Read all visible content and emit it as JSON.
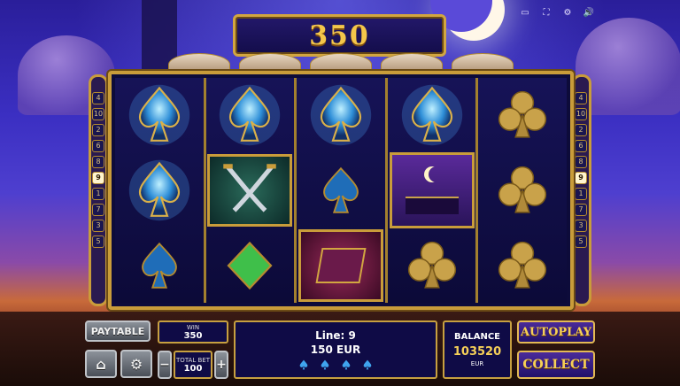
{
  "win_display": {
    "amount": "350"
  },
  "top_icons": [
    "menu-icon",
    "fullscreen-icon",
    "settings-icon",
    "sound-icon"
  ],
  "top_icon_glyphs": [
    "▭",
    "⛶",
    "⚙",
    "🔊"
  ],
  "paylines_left": [
    "4",
    "10",
    "2",
    "6",
    "8",
    "9",
    "1",
    "7",
    "3",
    "5"
  ],
  "paylines_right": [
    "4",
    "10",
    "2",
    "6",
    "8",
    "9",
    "1",
    "7",
    "3",
    "5"
  ],
  "active_payline": "9",
  "reels": [
    [
      "spade-glow",
      "spade-glow",
      "spade"
    ],
    [
      "spade-glow",
      "swords",
      "diamond"
    ],
    [
      "spade-glow",
      "spade",
      "carpet"
    ],
    [
      "spade-glow",
      "palace",
      "club"
    ],
    [
      "club",
      "club",
      "club"
    ]
  ],
  "controls": {
    "paytable_label": "PAYTABLE",
    "win_label": "WIN",
    "win_value": "350",
    "total_bet_label": "TOTAL BET",
    "total_bet_value": "100",
    "minus": "−",
    "plus": "+",
    "line_text": "Line: 9",
    "line_win": "150 EUR",
    "balance_label": "BALANCE",
    "balance_value": "103520",
    "balance_currency": "EUR",
    "autoplay_label": "AUTOPLAY",
    "collect_label": "COLLECT"
  },
  "colors": {
    "gold": "#d2a640",
    "spade_blue": "#2f8fd8",
    "club_gold": "#c9a24a",
    "diamond_green": "#3fbf4a"
  }
}
